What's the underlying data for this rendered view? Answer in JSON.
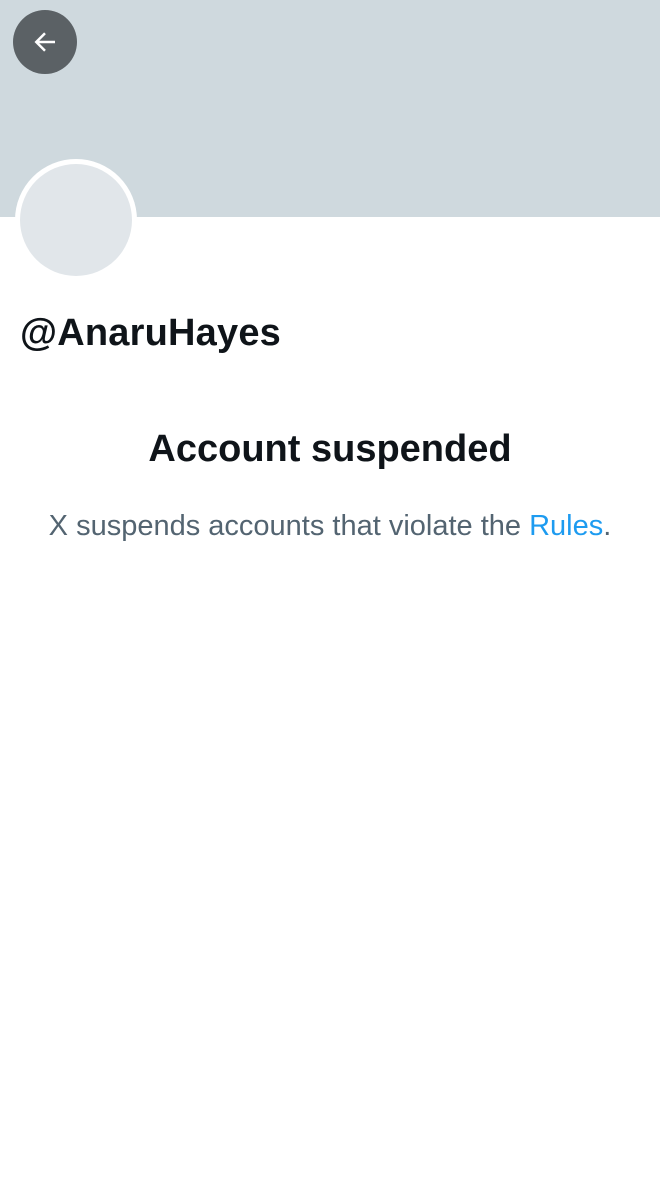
{
  "header": {
    "back_icon": "arrow-left-icon",
    "banner_color": "#cfd9de",
    "back_button_color": "#5b6165"
  },
  "profile": {
    "handle": "@AnaruHayes",
    "avatar_color": "#e1e6ea"
  },
  "notice": {
    "title": "Account suspended",
    "body_text": "X suspends accounts that violate the",
    "link_text": "Rules",
    "trailing": ".",
    "link_color": "#1d9bf0"
  }
}
